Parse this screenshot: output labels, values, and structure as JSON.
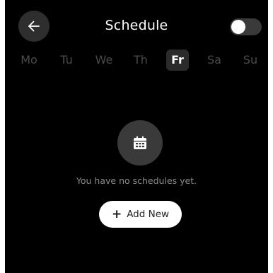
{
  "header": {
    "title": "Schedule",
    "back_icon": "arrow-left-icon",
    "toggle_on": false
  },
  "days": [
    {
      "label": "Mo",
      "selected": false
    },
    {
      "label": "Tu",
      "selected": false
    },
    {
      "label": "We",
      "selected": false
    },
    {
      "label": "Th",
      "selected": false
    },
    {
      "label": "Fr",
      "selected": true
    },
    {
      "label": "Sa",
      "selected": false
    },
    {
      "label": "Su",
      "selected": false
    }
  ],
  "empty_state": {
    "icon": "calendar-icon",
    "message": "You have no schedules yet."
  },
  "add_button": {
    "icon": "plus-icon",
    "label": "Add New"
  },
  "colors": {
    "background": "#000000",
    "button_bg": "#ffffff",
    "muted_text": "#8a8a8a",
    "inactive_day": "#4a4a4a"
  }
}
